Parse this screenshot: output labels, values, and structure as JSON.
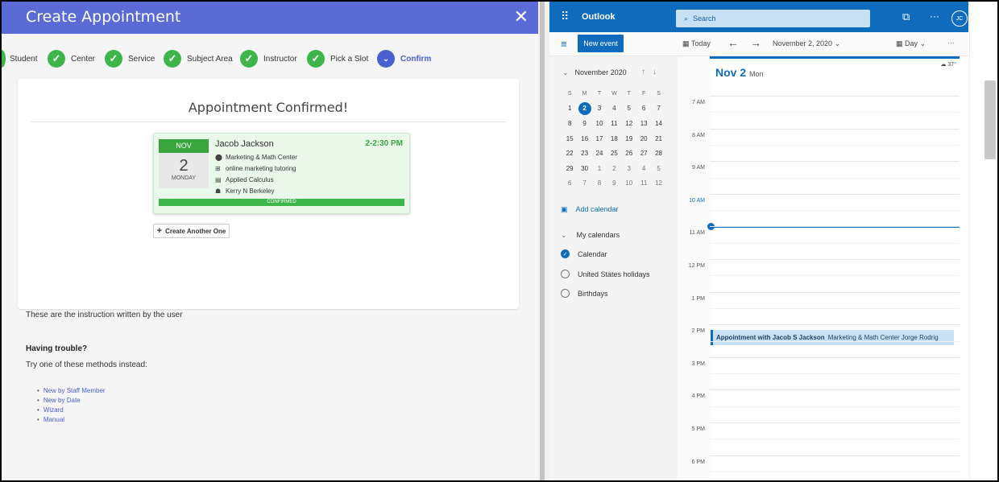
{
  "left": {
    "title": "Create Appointment",
    "close_glyph": "✕",
    "steps": [
      {
        "label": "Student",
        "icon": "check-icon"
      },
      {
        "label": "Center",
        "icon": "check-icon"
      },
      {
        "label": "Service",
        "icon": "check-icon"
      },
      {
        "label": "Subject Area",
        "icon": "check-icon"
      },
      {
        "label": "Instructor",
        "icon": "check-icon"
      },
      {
        "label": "Pick a Slot",
        "icon": "check-icon"
      },
      {
        "label": "Confirm",
        "icon": "chevron-down-icon",
        "current": true
      }
    ],
    "confirmed_title": "Appointment Confirmed!",
    "appointment": {
      "month": "NOV",
      "day": "2",
      "weekday": "MONDAY",
      "name": "Jacob Jackson",
      "time": "2-2:30 PM",
      "center": "Marketing & Math Center",
      "service": "online marketing tutoring",
      "subject": "Applied Calculus",
      "instructor": "Kerry N Berkeley",
      "status": "CONFIRMED"
    },
    "create_another": "Create Another One",
    "instruction": "These are the instruction written by the user",
    "trouble_title": "Having trouble?",
    "trouble_text": "Try one of these methods instead:",
    "methods": [
      "New by Staff Member",
      "New by Date",
      "Wizard",
      "Manual"
    ],
    "colors": {
      "header": "#5b6bd5",
      "success": "#3db54a"
    }
  },
  "outlook": {
    "app_name": "Outlook",
    "search_placeholder": "Search",
    "avatar": "JC",
    "new_event": "New event",
    "today": "Today",
    "current_date": "November 2, 2020",
    "view_mode": "Day",
    "mini_month": "November 2020",
    "weekdays": [
      "S",
      "M",
      "T",
      "W",
      "T",
      "F",
      "S"
    ],
    "weeks": [
      [
        "1",
        "2",
        "3",
        "4",
        "5",
        "6",
        "7"
      ],
      [
        "8",
        "9",
        "10",
        "11",
        "12",
        "13",
        "14"
      ],
      [
        "15",
        "16",
        "17",
        "18",
        "19",
        "20",
        "21"
      ],
      [
        "22",
        "23",
        "24",
        "25",
        "26",
        "27",
        "28"
      ],
      [
        "29",
        "30",
        "1",
        "2",
        "3",
        "4",
        "5"
      ],
      [
        "6",
        "7",
        "8",
        "9",
        "10",
        "11",
        "12"
      ]
    ],
    "selected_day": "2",
    "add_calendar": "Add calendar",
    "my_calendars": "My calendars",
    "calendars": [
      {
        "label": "Calendar",
        "checked": true
      },
      {
        "label": "United States holidays",
        "checked": false
      },
      {
        "label": "Birthdays",
        "checked": false
      }
    ],
    "day_label": "Nov 2",
    "day_weekday": "Mon",
    "weather": "37°",
    "hours": [
      "7 AM",
      "8 AM",
      "9 AM",
      "10 AM",
      "11 AM",
      "12 PM",
      "1 PM",
      "2 PM",
      "3 PM",
      "4 PM",
      "5 PM",
      "6 PM"
    ],
    "current_hour": "10 AM",
    "event": {
      "title": "Appointment with Jacob S Jackson",
      "detail": "Marketing & Math Center Jorge Rodrig"
    },
    "colors": {
      "brand": "#0f6cbd",
      "event_bg": "#c7e0f4"
    }
  }
}
